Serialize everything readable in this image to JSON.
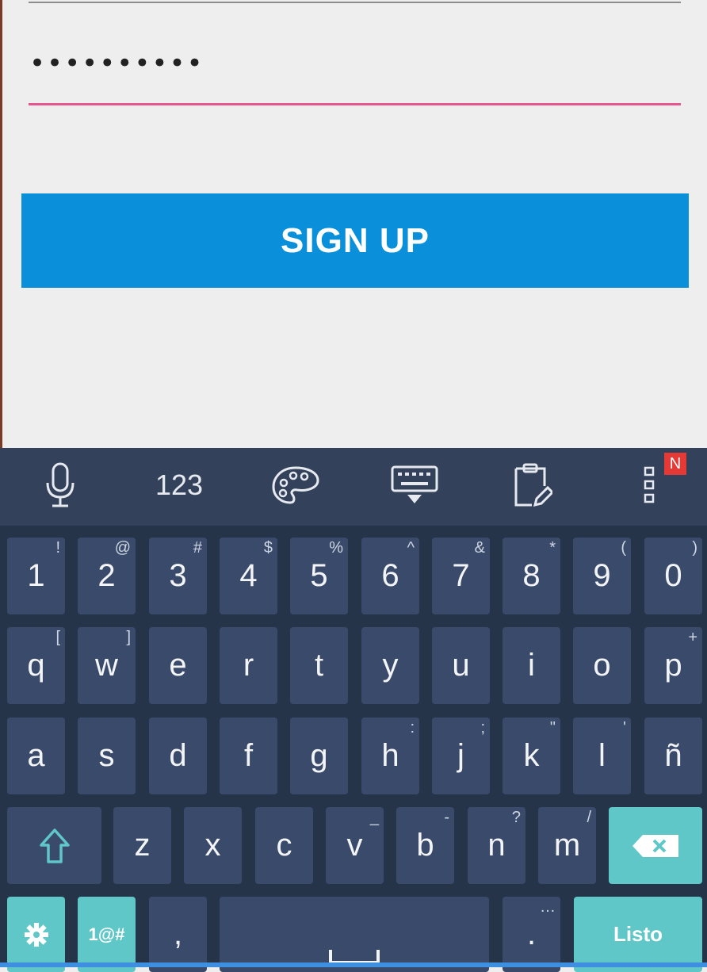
{
  "form": {
    "password_value": "••••••••••",
    "signup_label": "SIGN UP"
  },
  "keyboard": {
    "toolbar": {
      "numeric_label": "123",
      "badge": "N"
    },
    "rows": [
      [
        {
          "label": "1",
          "sub": "!"
        },
        {
          "label": "2",
          "sub": "@"
        },
        {
          "label": "3",
          "sub": "#"
        },
        {
          "label": "4",
          "sub": "$"
        },
        {
          "label": "5",
          "sub": "%"
        },
        {
          "label": "6",
          "sub": "^"
        },
        {
          "label": "7",
          "sub": "&"
        },
        {
          "label": "8",
          "sub": "*"
        },
        {
          "label": "9",
          "sub": "("
        },
        {
          "label": "0",
          "sub": ")"
        }
      ],
      [
        {
          "label": "q",
          "sub": "["
        },
        {
          "label": "w",
          "sub": "]"
        },
        {
          "label": "e",
          "sub": ""
        },
        {
          "label": "r",
          "sub": ""
        },
        {
          "label": "t",
          "sub": ""
        },
        {
          "label": "y",
          "sub": ""
        },
        {
          "label": "u",
          "sub": ""
        },
        {
          "label": "i",
          "sub": ""
        },
        {
          "label": "o",
          "sub": ""
        },
        {
          "label": "p",
          "sub": "+"
        }
      ],
      [
        {
          "label": "a",
          "sub": ""
        },
        {
          "label": "s",
          "sub": ""
        },
        {
          "label": "d",
          "sub": ""
        },
        {
          "label": "f",
          "sub": ""
        },
        {
          "label": "g",
          "sub": ""
        },
        {
          "label": "h",
          "sub": ":"
        },
        {
          "label": "j",
          "sub": ";"
        },
        {
          "label": "k",
          "sub": "\""
        },
        {
          "label": "l",
          "sub": "'"
        },
        {
          "label": "ñ",
          "sub": ""
        }
      ],
      [
        {
          "label": "z",
          "sub": ""
        },
        {
          "label": "x",
          "sub": ""
        },
        {
          "label": "c",
          "sub": ""
        },
        {
          "label": "v",
          "sub": "_"
        },
        {
          "label": "b",
          "sub": "-"
        },
        {
          "label": "n",
          "sub": "?"
        },
        {
          "label": "m",
          "sub": "/"
        }
      ]
    ],
    "bottom": {
      "symbols_label": "1@#",
      "comma_label": ",",
      "period_label": ".",
      "period_sub": "…",
      "done_label": "Listo"
    }
  }
}
